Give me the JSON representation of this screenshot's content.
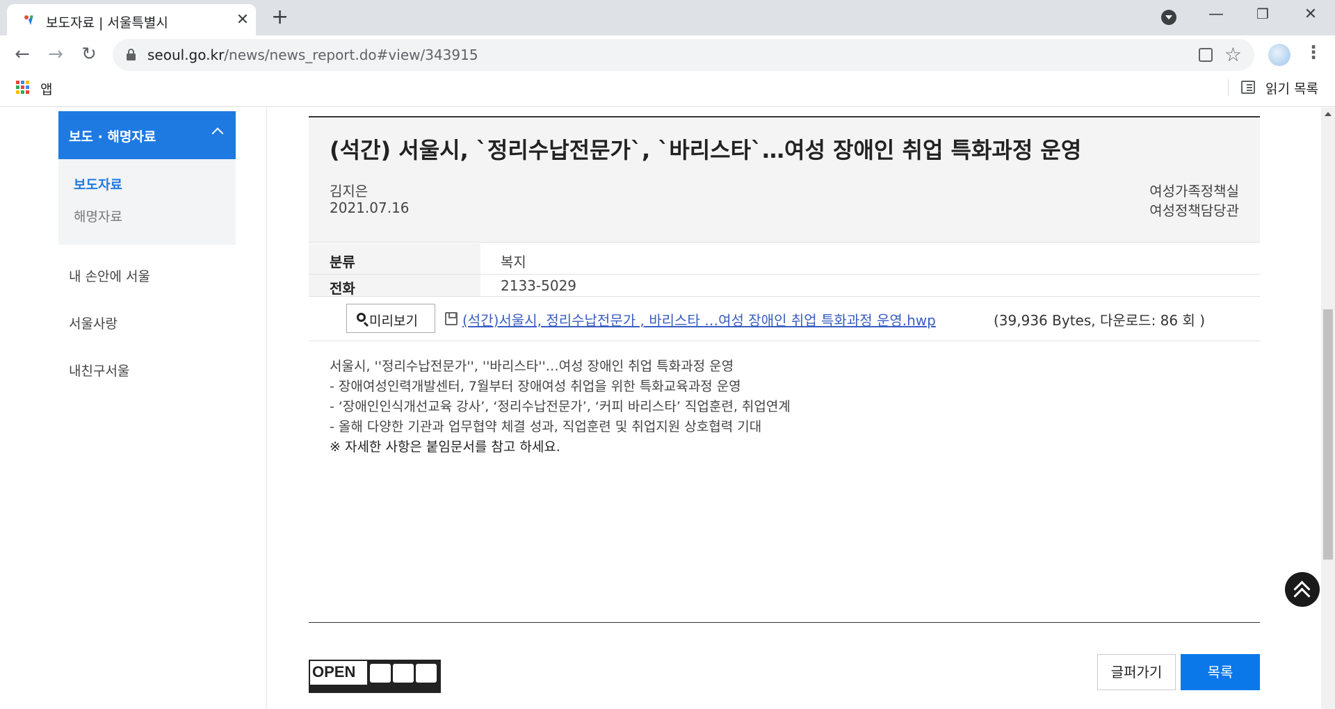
{
  "browser": {
    "tab_title": "보도자료 | 서울특별시",
    "url_host": "seoul.go.kr",
    "url_path": "/news/news_report.do#view/343915",
    "apps_label": "앱",
    "reading_list_label": "읽기 목록"
  },
  "sidebar": {
    "section_title": "보도 · 해명자료",
    "sub_items": [
      {
        "label": "보도자료",
        "active": true
      },
      {
        "label": "해명자료",
        "active": false
      }
    ],
    "items": [
      {
        "label": "내 손안에 서울"
      },
      {
        "label": "서울사랑"
      },
      {
        "label": "내친구서울"
      }
    ]
  },
  "article": {
    "title": "(석간) 서울시, `정리수납전문가`, `바리스타`…여성 장애인 취업 특화과정 운영",
    "author": "김지은",
    "date": "2021.07.16",
    "department": "여성가족정책실",
    "team": "여성정책담당관",
    "meta": [
      {
        "label": "분류",
        "value": "복지"
      },
      {
        "label": "전화",
        "value": "2133-5029"
      }
    ],
    "attachment": {
      "preview_label": "미리보기",
      "filename": "(석간)서울시,  정리수납전문가 ,  바리스타 …여성 장애인 취업 특화과정 운영.hwp",
      "info": "(39,936 Bytes, 다운로드: 86 회 )"
    },
    "body": [
      "서울시, ''정리수납전문가'', ''바리스타''…여성 장애인 취업 특화과정 운영",
      " - 장애여성인력개발센터, 7월부터 장애여성 취업을 위한 특화교육과정 운영",
      " - ‘장애인인식개선교육 강사’, ‘정리수납전문가’, ‘커피 바리스타’ 직업훈련, 취업연계",
      " - 올해 다양한 기관과 업무협약 체결 성과, 직업훈련 및 취업지원 상호협력 기대",
      "※ 자세한 사항은 붙임문서를 참고 하세요."
    ]
  },
  "footer": {
    "open_logo_text": "OPEN",
    "share_label": "글퍼가기",
    "list_label": "목록"
  },
  "colors": {
    "accent": "#1e7ae0",
    "primary_button": "#0a78e8",
    "link": "#3a5ec0"
  },
  "icons": [
    "close-icon",
    "plus-icon",
    "back-icon",
    "forward-icon",
    "reload-icon",
    "lock-icon",
    "qr-icon",
    "star-icon",
    "menu-dots-icon",
    "apps-icon",
    "reading-list-icon",
    "chevron-up-icon",
    "magnifier-icon",
    "file-icon",
    "scroll-top-icon"
  ]
}
